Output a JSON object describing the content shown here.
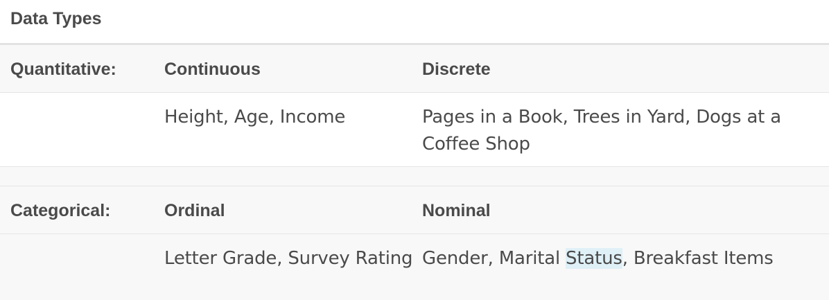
{
  "caption": "Data Types",
  "sections": [
    {
      "group_label": "Quantitative:",
      "col1_header": "Continuous",
      "col2_header": "Discrete",
      "col1_text": "Height, Age, Income",
      "col2_text": "Pages in a Book, Trees in Yard, Dogs at a Coffee Shop"
    },
    {
      "group_label": "Categorical:",
      "col1_header": "Ordinal",
      "col2_header": "Nominal",
      "col1_text": "Letter Grade, Survey Rating",
      "col2_text_before": "Gender, Marital ",
      "col2_text_highlight": "Status",
      "col2_text_after": ", Breakfast Items"
    }
  ],
  "colors": {
    "text": "#4a4a4a",
    "header_bg": "#f8f8f8",
    "highlight": "#dff0f7"
  }
}
